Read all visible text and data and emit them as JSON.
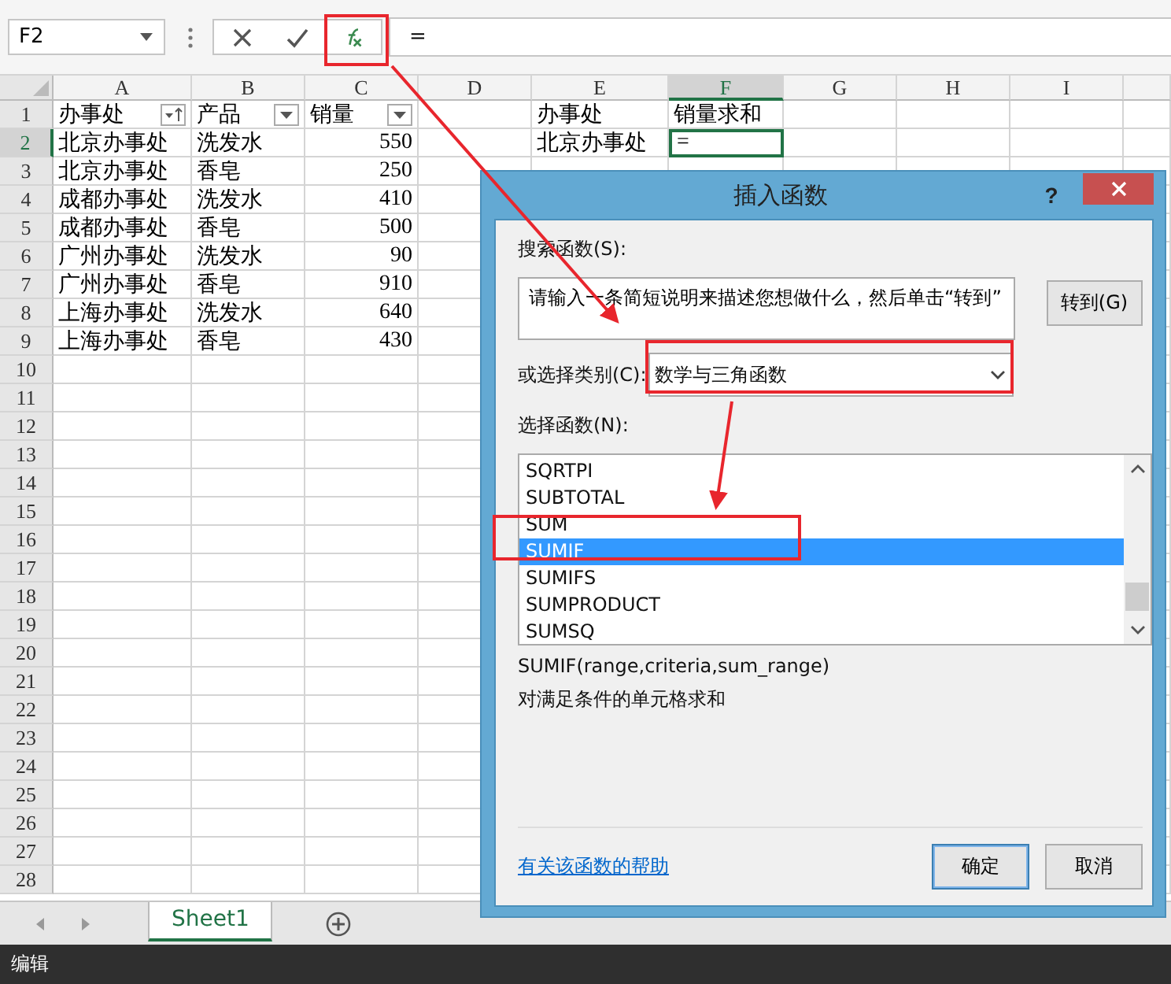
{
  "formula_bar": {
    "name_box": "F2",
    "formula": "="
  },
  "columns": [
    {
      "label": "A",
      "selected": false
    },
    {
      "label": "B",
      "selected": false
    },
    {
      "label": "C",
      "selected": false
    },
    {
      "label": "D",
      "selected": false
    },
    {
      "label": "E",
      "selected": false
    },
    {
      "label": "F",
      "selected": true
    },
    {
      "label": "G",
      "selected": false
    },
    {
      "label": "H",
      "selected": false
    },
    {
      "label": "I",
      "selected": false
    }
  ],
  "rows": [
    {
      "number": "1",
      "selected": false,
      "cells": {
        "A": {
          "text": "办事处",
          "filter": true,
          "sorted": true
        },
        "B": {
          "text": "产品",
          "filter": true,
          "sorted": false
        },
        "C": {
          "text": "销量",
          "filter": true,
          "sorted": false
        },
        "E": "办事处",
        "F": "销量求和"
      }
    },
    {
      "number": "2",
      "selected": true,
      "cells": {
        "A": "北京办事处",
        "B": "洗发水",
        "C": {
          "text": "550",
          "numeric": true
        },
        "E": "北京办事处",
        "F": {
          "text": "=",
          "active": true
        }
      }
    },
    {
      "number": "3",
      "selected": false,
      "cells": {
        "A": "北京办事处",
        "B": "香皂",
        "C": {
          "text": "250",
          "numeric": true
        }
      }
    },
    {
      "number": "4",
      "selected": false,
      "cells": {
        "A": "成都办事处",
        "B": "洗发水",
        "C": {
          "text": "410",
          "numeric": true
        }
      }
    },
    {
      "number": "5",
      "selected": false,
      "cells": {
        "A": "成都办事处",
        "B": "香皂",
        "C": {
          "text": "500",
          "numeric": true
        }
      }
    },
    {
      "number": "6",
      "selected": false,
      "cells": {
        "A": "广州办事处",
        "B": "洗发水",
        "C": {
          "text": "90",
          "numeric": true
        }
      }
    },
    {
      "number": "7",
      "selected": false,
      "cells": {
        "A": "广州办事处",
        "B": "香皂",
        "C": {
          "text": "910",
          "numeric": true
        }
      }
    },
    {
      "number": "8",
      "selected": false,
      "cells": {
        "A": "上海办事处",
        "B": "洗发水",
        "C": {
          "text": "640",
          "numeric": true
        }
      }
    },
    {
      "number": "9",
      "selected": false,
      "cells": {
        "A": "上海办事处",
        "B": "香皂",
        "C": {
          "text": "430",
          "numeric": true
        }
      }
    },
    {
      "number": "10",
      "selected": false
    },
    {
      "number": "11",
      "selected": false
    },
    {
      "number": "12",
      "selected": false
    },
    {
      "number": "13",
      "selected": false
    },
    {
      "number": "14",
      "selected": false
    },
    {
      "number": "15",
      "selected": false
    },
    {
      "number": "16",
      "selected": false
    },
    {
      "number": "17",
      "selected": false
    },
    {
      "number": "18",
      "selected": false
    },
    {
      "number": "19",
      "selected": false
    },
    {
      "number": "20",
      "selected": false
    },
    {
      "number": "21",
      "selected": false
    },
    {
      "number": "22",
      "selected": false
    },
    {
      "number": "23",
      "selected": false
    },
    {
      "number": "24",
      "selected": false
    },
    {
      "number": "25",
      "selected": false
    },
    {
      "number": "26",
      "selected": false
    },
    {
      "number": "27",
      "selected": false
    },
    {
      "number": "28",
      "selected": false
    }
  ],
  "sheet_tabs": [
    {
      "label": "Sheet1",
      "selected": true
    }
  ],
  "status_bar": "编辑",
  "dialog": {
    "title": "插入函数",
    "help_button": "?",
    "search_label": "搜索函数(S):",
    "search_field": {
      "value": "请输入一条简短说明来描述您想做什么，然后单击“转到”"
    },
    "go_button": "转到(G)",
    "category_label": "或选择类别(C):",
    "category": {
      "value": "数学与三角函数"
    },
    "function_label": "选择函数(N):",
    "functions": [
      {
        "name": "SQRTPI",
        "selected": false
      },
      {
        "name": "SUBTOTAL",
        "selected": false
      },
      {
        "name": "SUM",
        "selected": false
      },
      {
        "name": "SUMIF",
        "selected": true
      },
      {
        "name": "SUMIFS",
        "selected": false
      },
      {
        "name": "SUMPRODUCT",
        "selected": false
      },
      {
        "name": "SUMSQ",
        "selected": false
      }
    ],
    "syntax": "SUMIF(range,criteria,sum_range)",
    "description": "对满足条件的单元格求和",
    "help_link": "有关该函数的帮助",
    "buttons": [
      {
        "label": "确定",
        "default": true
      },
      {
        "label": "取消",
        "default": false
      }
    ]
  }
}
